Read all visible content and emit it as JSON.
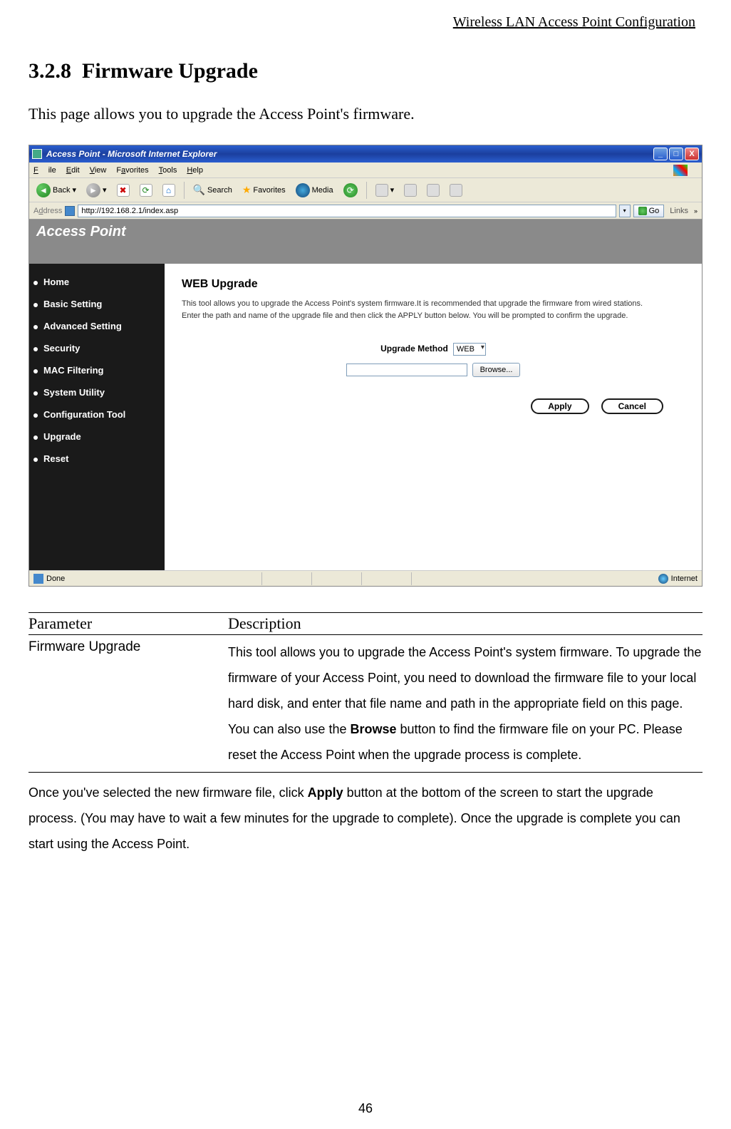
{
  "doc": {
    "runningHeader": "Wireless LAN Access Point Configuration",
    "sectionNumber": "3.2.8",
    "sectionTitle": "Firmware Upgrade",
    "intro": "This page allows you to upgrade the Access Point's firmware.",
    "pageNumber": "46"
  },
  "ie": {
    "title": "Access Point - Microsoft Internet Explorer",
    "menu": {
      "file": "File",
      "edit": "Edit",
      "view": "View",
      "favorites": "Favorites",
      "tools": "Tools",
      "help": "Help"
    },
    "toolbar": {
      "back": "Back",
      "search": "Search",
      "favorites": "Favorites",
      "media": "Media"
    },
    "address": {
      "label": "Address",
      "url": "http://192.168.2.1/index.asp",
      "go": "Go",
      "links": "Links"
    },
    "status": {
      "done": "Done",
      "zone": "Internet"
    }
  },
  "ap": {
    "banner": "Access Point",
    "nav": [
      "Home",
      "Basic Setting",
      "Advanced Setting",
      "Security",
      "MAC Filtering",
      "System Utility",
      "Configuration Tool",
      "Upgrade",
      "Reset"
    ],
    "page": {
      "title": "WEB Upgrade",
      "desc1": "This tool allows you to upgrade the Access Point's system firmware.It is recommended that upgrade the firmware from wired stations.",
      "desc2": "Enter the path and name of the upgrade file and then click the APPLY button below. You will be prompted to confirm the upgrade.",
      "methodLabel": "Upgrade Method",
      "methodValue": "WEB",
      "fileValue": "",
      "browse": "Browse...",
      "apply": "Apply",
      "cancel": "Cancel"
    }
  },
  "table": {
    "headParam": "Parameter",
    "headDesc": "Description",
    "rowParam": "Firmware Upgrade",
    "rowDesc": "This tool allows you to upgrade the Access Point's system firmware. To upgrade the firmware of your Access Point, you need to download the firmware file to your local hard disk, and enter that file name and path in the appropriate field on this page. You can also use the Browse button to find the firmware file on your PC. Please reset the Access Point when the upgrade process is complete.",
    "followup": "Once you've selected the new firmware file, click Apply button at the bottom of the screen to start the upgrade process. (You may have to wait a few minutes for the upgrade to complete). Once the upgrade is complete you can start using the Access Point."
  }
}
